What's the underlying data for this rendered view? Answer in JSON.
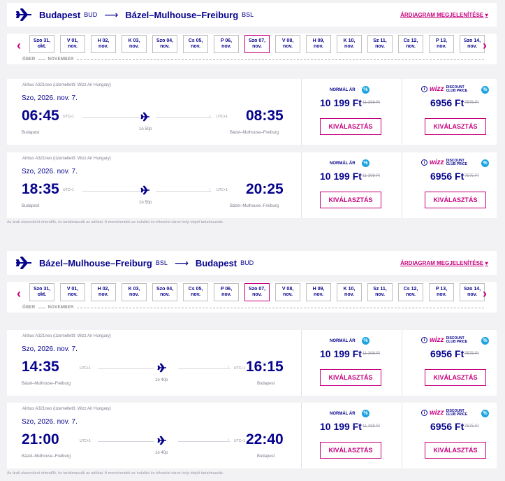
{
  "outbound": {
    "from_city": "Budapest",
    "from_code": "BUD",
    "to_city": "Bázel–Mulhouse–Freiburg",
    "to_code": "BSL",
    "arrow": "⟶",
    "chart_link": "ÁRDIAGRAM MEGJELENÍTÉSE",
    "month_prev": "ÓBER",
    "month_next": "NOVEMBER",
    "dates": [
      {
        "l1": "Szo 31,",
        "l2": "okt."
      },
      {
        "l1": "V 01,",
        "l2": "nov."
      },
      {
        "l1": "H 02,",
        "l2": "nov."
      },
      {
        "l1": "K 03,",
        "l2": "nov."
      },
      {
        "l1": "Szo 04,",
        "l2": "nov."
      },
      {
        "l1": "Cs 05,",
        "l2": "nov."
      },
      {
        "l1": "P 06,",
        "l2": "nov."
      },
      {
        "l1": "Szo 07,",
        "l2": "nov."
      },
      {
        "l1": "V 08,",
        "l2": "nov."
      },
      {
        "l1": "H 09,",
        "l2": "nov."
      },
      {
        "l1": "K 10,",
        "l2": "nov."
      },
      {
        "l1": "Sz 11,",
        "l2": "nov."
      },
      {
        "l1": "Cs 12,",
        "l2": "nov."
      },
      {
        "l1": "P 13,",
        "l2": "nov."
      },
      {
        "l1": "Szo 14,",
        "l2": "nov."
      }
    ],
    "selected_index": 7,
    "flights": [
      {
        "aircraft": "Airbus A321neo (üzemeltető: Wizz Air Hungary)",
        "date": "Szo, 2026. nov. 7.",
        "dep_time": "06:45",
        "arr_time": "08:35",
        "dep_utc": "UTC+1",
        "arr_utc": "UTC+1",
        "duration": "1ó 50p",
        "dep_city": "Budapest",
        "arr_city": "Bázel–Mulhouse–Freiburg",
        "normal_label": "NORMÁL ÁR",
        "normal_price": "10 199 Ft",
        "normal_old": "11 398 Ft",
        "club_price": "6956 Ft",
        "club_old": "7575 Ft",
        "select": "KIVÁLASZTÁS"
      },
      {
        "aircraft": "Airbus A321neo (üzemeltető: Wizz Air Hungary)",
        "date": "Szo, 2026. nov. 7.",
        "dep_time": "18:35",
        "arr_time": "20:25",
        "dep_utc": "UTC+1",
        "arr_utc": "UTC+1",
        "duration": "1ó 50p",
        "dep_city": "Budapest",
        "arr_city": "Bázel–Mulhouse–Freiburg",
        "normal_label": "NORMÁL ÁR",
        "normal_price": "10 199 Ft",
        "normal_old": "11 398 Ft",
        "club_price": "6956 Ft",
        "club_old": "7575 Ft",
        "select": "KIVÁLASZTÁS"
      }
    ],
    "footnote": "Az árak utasonként értendők, és tartalmazzák az adókat. A menetrendek az indulási és érkezési város helyi idejét tartalmazzák."
  },
  "return": {
    "from_city": "Bázel–Mulhouse–Freiburg",
    "from_code": "BSL",
    "to_city": "Budapest",
    "to_code": "BUD",
    "arrow": "⟶",
    "chart_link": "ÁRDIAGRAM MEGJELENÍTÉSE",
    "month_prev": "ÓBER",
    "month_next": "NOVEMBER",
    "dates": [
      {
        "l1": "Szo 31,",
        "l2": "okt."
      },
      {
        "l1": "V 01,",
        "l2": "nov."
      },
      {
        "l1": "H 02,",
        "l2": "nov."
      },
      {
        "l1": "K 03,",
        "l2": "nov."
      },
      {
        "l1": "Szo 04,",
        "l2": "nov."
      },
      {
        "l1": "Cs 05,",
        "l2": "nov."
      },
      {
        "l1": "P 06,",
        "l2": "nov."
      },
      {
        "l1": "Szo 07,",
        "l2": "nov."
      },
      {
        "l1": "V 08,",
        "l2": "nov."
      },
      {
        "l1": "H 09,",
        "l2": "nov."
      },
      {
        "l1": "K 10,",
        "l2": "nov."
      },
      {
        "l1": "Sz 11,",
        "l2": "nov."
      },
      {
        "l1": "Cs 12,",
        "l2": "nov."
      },
      {
        "l1": "P 13,",
        "l2": "nov."
      },
      {
        "l1": "Szo 14,",
        "l2": "nov."
      }
    ],
    "selected_index": 7,
    "flights": [
      {
        "aircraft": "Airbus A321neo (üzemeltető: Wizz Air Hungary)",
        "date": "Szo, 2026. nov. 7.",
        "dep_time": "14:35",
        "arr_time": "16:15",
        "dep_utc": "UTC+1",
        "arr_utc": "UTC+1",
        "duration": "1ó 40p",
        "dep_city": "Bázel–Mulhouse–Freiburg",
        "arr_city": "Budapest",
        "normal_label": "NORMÁL ÁR",
        "normal_price": "10 199 Ft",
        "normal_old": "11 398 Ft",
        "club_price": "6956 Ft",
        "club_old": "7575 Ft",
        "select": "KIVÁLASZTÁS"
      },
      {
        "aircraft": "Airbus A321neo (üzemeltető: Wizz Air Hungary)",
        "date": "Szo, 2026. nov. 7.",
        "dep_time": "21:00",
        "arr_time": "22:40",
        "dep_utc": "UTC+1",
        "arr_utc": "UTC+1",
        "duration": "1ó 40p",
        "dep_city": "Bázel–Mulhouse–Freiburg",
        "arr_city": "Budapest",
        "normal_label": "NORMÁL ÁR",
        "normal_price": "10 199 Ft",
        "normal_old": "11 398 Ft",
        "club_price": "6956 Ft",
        "club_old": "7575 Ft",
        "select": "KIVÁLASZTÁS"
      }
    ],
    "footnote": "Az árak utasonként értendők, és tartalmazzák az adókat. A menetrendek az indulási és érkezési város helyi idejét tartalmazzák."
  },
  "club_badge": {
    "brand": "wizz",
    "line1": "DISCOUNT",
    "line2": "CLUB PRICE"
  },
  "icons": {
    "prev": "chevron-left-icon",
    "next": "chevron-right-icon",
    "plane": "airplane-icon",
    "discount": "percent-icon",
    "info": "info-icon",
    "heart": "heart-icon"
  },
  "colors": {
    "brand_navy": "#06038d",
    "brand_magenta": "#c6007e",
    "discount_blue": "#1aa3e0"
  }
}
